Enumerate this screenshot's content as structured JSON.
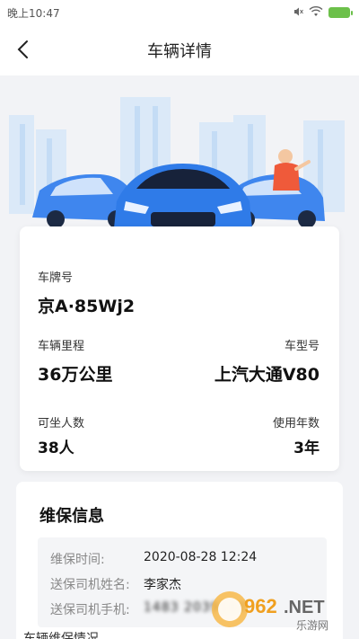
{
  "status_bar": {
    "time": "晚上10:47",
    "wifi_icon": "wifi-icon",
    "battery_icon": "battery-icon",
    "signal_icon": "signal-icon"
  },
  "nav": {
    "back_icon": "chevron-left-icon",
    "title": "车辆详情"
  },
  "vehicle": {
    "plate_label": "车牌号",
    "plate_value": "京A·85Wj2",
    "mileage_label": "车辆里程",
    "mileage_value": "36万公里",
    "model_label": "车型号",
    "model_value": "上汽大通V80",
    "seats_label": "可坐人数",
    "seats_value": "38人",
    "years_label": "使用年数",
    "years_value": "3年"
  },
  "maintenance": {
    "title": "维保信息",
    "rows": [
      {
        "label": "维保时间:",
        "value": "2020-08-28 12:24"
      },
      {
        "label": "送保司机姓名:",
        "value": "李家杰"
      },
      {
        "label": "送保司机手机:",
        "value": "1483 2039183"
      }
    ],
    "next_section_partial": "车辆维保情况"
  },
  "watermark": {
    "number": "962",
    "suffix": ".NET",
    "subtitle": "乐游网"
  },
  "colors": {
    "accent_blue": "#2f7be8",
    "background": "#f2f3f6",
    "card": "#ffffff"
  }
}
